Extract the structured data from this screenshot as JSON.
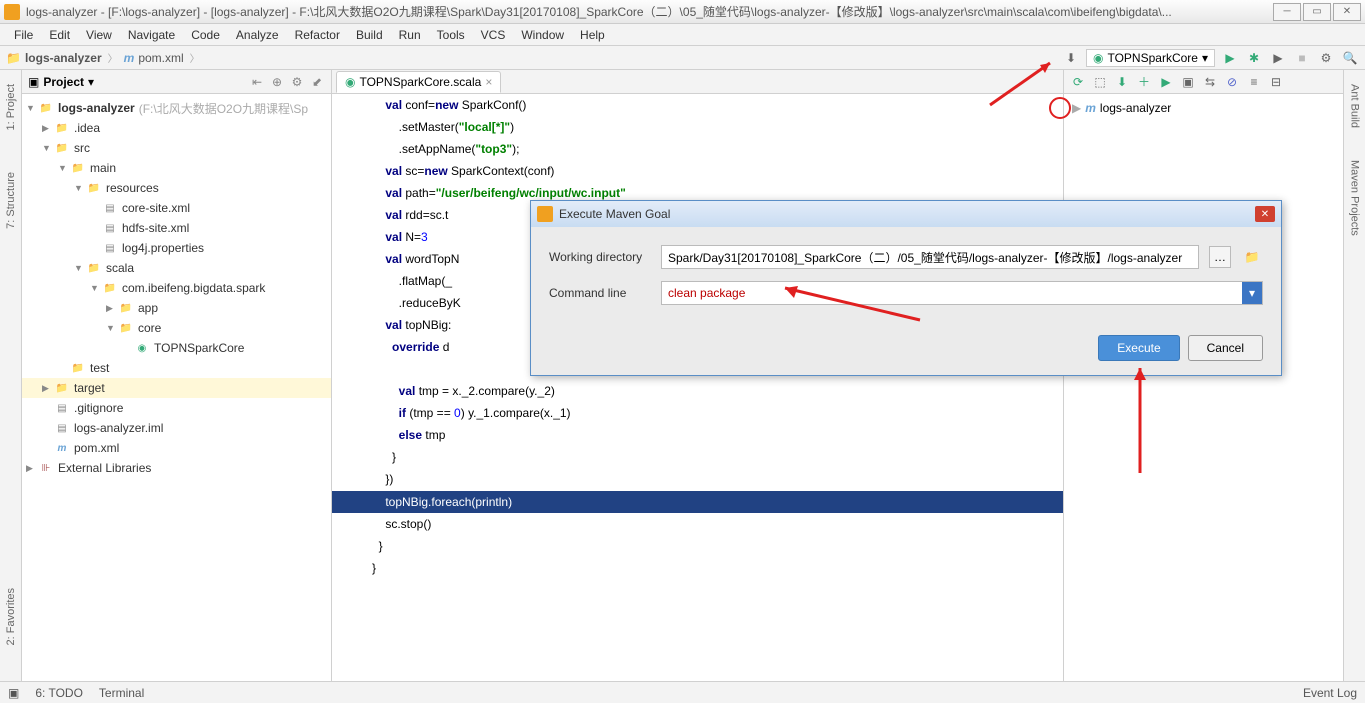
{
  "titlebar": {
    "text": "logs-analyzer - [F:\\logs-analyzer] - [logs-analyzer] - F:\\北风大数据O2O九期课程\\Spark\\Day31[20170108]_SparkCore（二）\\05_随堂代码\\logs-analyzer-【修改版】\\logs-analyzer\\src\\main\\scala\\com\\ibeifeng\\bigdata\\..."
  },
  "menus": [
    "File",
    "Edit",
    "View",
    "Navigate",
    "Code",
    "Analyze",
    "Refactor",
    "Build",
    "Run",
    "Tools",
    "VCS",
    "Window",
    "Help"
  ],
  "breadcrumb": {
    "project": "logs-analyzer",
    "file": "pom.xml"
  },
  "run_config": "TOPNSparkCore",
  "project_panel": {
    "title": "Project"
  },
  "tree": {
    "root": "logs-analyzer",
    "root_hint": "(F:\\北风大数据O2O九期课程\\Sp",
    "items": [
      {
        "indent": 1,
        "arrow": "▶",
        "icon": "folder",
        "label": ".idea"
      },
      {
        "indent": 1,
        "arrow": "▼",
        "icon": "folder",
        "label": "src"
      },
      {
        "indent": 2,
        "arrow": "▼",
        "icon": "folder",
        "label": "main"
      },
      {
        "indent": 3,
        "arrow": "▼",
        "icon": "folder",
        "label": "resources"
      },
      {
        "indent": 4,
        "arrow": "",
        "icon": "file",
        "label": "core-site.xml"
      },
      {
        "indent": 4,
        "arrow": "",
        "icon": "file",
        "label": "hdfs-site.xml"
      },
      {
        "indent": 4,
        "arrow": "",
        "icon": "file",
        "label": "log4j.properties"
      },
      {
        "indent": 3,
        "arrow": "▼",
        "icon": "folder",
        "label": "scala"
      },
      {
        "indent": 4,
        "arrow": "▼",
        "icon": "folder",
        "label": "com.ibeifeng.bigdata.spark"
      },
      {
        "indent": 5,
        "arrow": "▶",
        "icon": "folder",
        "label": "app"
      },
      {
        "indent": 5,
        "arrow": "▼",
        "icon": "folder",
        "label": "core"
      },
      {
        "indent": 6,
        "arrow": "",
        "icon": "obj",
        "label": "TOPNSparkCore"
      },
      {
        "indent": 2,
        "arrow": "",
        "icon": "folder",
        "label": "test"
      },
      {
        "indent": 1,
        "arrow": "▶",
        "icon": "folder-red",
        "label": "target",
        "sel": true
      },
      {
        "indent": 1,
        "arrow": "",
        "icon": "file",
        "label": ".gitignore"
      },
      {
        "indent": 1,
        "arrow": "",
        "icon": "file",
        "label": "logs-analyzer.iml"
      },
      {
        "indent": 1,
        "arrow": "",
        "icon": "m",
        "label": "pom.xml"
      }
    ],
    "ext_lib": "External Libraries"
  },
  "tab": {
    "name": "TOPNSparkCore.scala"
  },
  "code_lines": [
    {
      "t": "    val conf=new SparkConf()",
      "p": [
        [
          "kw",
          "val"
        ],
        [
          "",
          ""
        ]
      ]
    },
    {
      "t": "        .setMaster(\"local[*]\")"
    },
    {
      "t": "        .setAppName(\"top3\");"
    },
    {
      "t": "    val sc=new SparkContext(conf)"
    },
    {
      "t": "    val path=\"/user/beifeng/wc/input/wc.input\""
    },
    {
      "t": "    val rdd=sc.t"
    },
    {
      "t": "    val N=3"
    },
    {
      "t": "    val wordTopN"
    },
    {
      "t": "        .flatMap(_"
    },
    {
      "t": "        .reduceByK"
    },
    {
      "t": "    val topNBig:"
    },
    {
      "t": "      override d"
    },
    {
      "t": ""
    },
    {
      "t": "        val tmp = x._2.compare(y._2)"
    },
    {
      "t": "        if (tmp == 0) y._1.compare(x._1)"
    },
    {
      "t": "        else tmp"
    },
    {
      "t": "      }"
    },
    {
      "t": "    })"
    },
    {
      "t": "    topNBig.foreach(println)",
      "hl": true
    },
    {
      "t": "    sc.stop()"
    },
    {
      "t": "  }"
    },
    {
      "t": "}"
    }
  ],
  "maven": {
    "root": "logs-analyzer"
  },
  "dialog": {
    "title": "Execute Maven Goal",
    "wd_label": "Working directory",
    "wd_value": "Spark/Day31[20170108]_SparkCore（二）/05_随堂代码/logs-analyzer-【修改版】/logs-analyzer",
    "cmd_label": "Command line",
    "cmd_value": "clean package",
    "execute": "Execute",
    "cancel": "Cancel"
  },
  "status": {
    "todo": "6: TODO",
    "terminal": "Terminal",
    "eventlog": "Event Log"
  },
  "sidetabs": {
    "project": "1: Project",
    "structure": "7: Structure",
    "favorites": "2: Favorites",
    "ant": "Ant Build",
    "maven": "Maven Projects"
  }
}
